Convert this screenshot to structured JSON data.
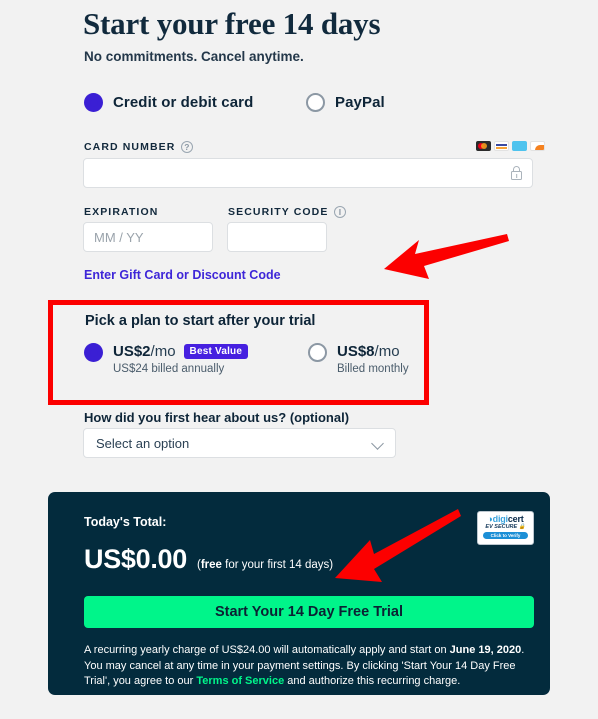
{
  "header": {
    "title": "Start your free 14 days",
    "subtitle": "No commitments. Cancel anytime."
  },
  "payment_methods": {
    "options": [
      {
        "label": "Credit or debit card",
        "selected": true
      },
      {
        "label": "PayPal",
        "selected": false
      }
    ]
  },
  "card_form": {
    "card_number_label": "CARD NUMBER",
    "card_number_help_icon": "question-mark-icon",
    "card_number_value": "",
    "card_number_lock_icon": "lock-icon",
    "accepted_cards": [
      "mastercard-icon",
      "visa-icon",
      "amex-icon",
      "discover-icon"
    ],
    "expiration_label": "EXPIRATION",
    "expiration_placeholder": "MM / YY",
    "expiration_value": "",
    "security_code_label": "SECURITY CODE",
    "security_code_help_icon": "info-icon",
    "security_code_value": "",
    "gift_card_link": "Enter Gift Card or Discount Code"
  },
  "plan": {
    "heading": "Pick a plan to start after your trial",
    "options": [
      {
        "price": "US$2",
        "period": "/mo",
        "badge": "Best Value",
        "sub": "US$24 billed annually",
        "selected": true
      },
      {
        "price": "US$8",
        "period": "/mo",
        "badge": "",
        "sub": "Billed monthly",
        "selected": false
      }
    ],
    "highlight_color": "#fc0000"
  },
  "referral": {
    "label": "How did you first hear about us? (optional)",
    "selected": "Select an option",
    "chevron_icon": "chevron-down-icon"
  },
  "total_panel": {
    "today_label": "Today's Total:",
    "amount": "US$0.00",
    "note_bold": "free",
    "note_rest": " for your first 14 days)",
    "note_open": "(",
    "trust_badge": {
      "brand_prefix": "digi",
      "brand_suffix": "cert",
      "secure_text": "EV SECURE",
      "verify_text": "Click to Verify",
      "lock_icon": "lock-icon"
    },
    "cta_label": "Start Your 14 Day Free Trial",
    "fineprint": {
      "part1": "A recurring yearly charge of US$24.00 will automatically apply and start on ",
      "date": "June 19, 2020",
      "part2": ". You may cancel at any time in your payment settings. By clicking 'Start Your 14 Day Free Trial', you agree to our ",
      "terms_link": "Terms of Service",
      "part3": " and authorize this recurring charge."
    }
  },
  "annotations": {
    "arrows": [
      {
        "name": "arrow-to-plan-box",
        "color": "#fc0000"
      },
      {
        "name": "arrow-to-cta-button",
        "color": "#fc0000"
      }
    ]
  },
  "colors": {
    "background": "#f2f2f2",
    "accent_purple": "#3a1fd4",
    "badge_purple": "#4620e0",
    "panel_dark": "#032b3d",
    "cta_green": "#00f58a",
    "annotation_red": "#fc0000"
  }
}
